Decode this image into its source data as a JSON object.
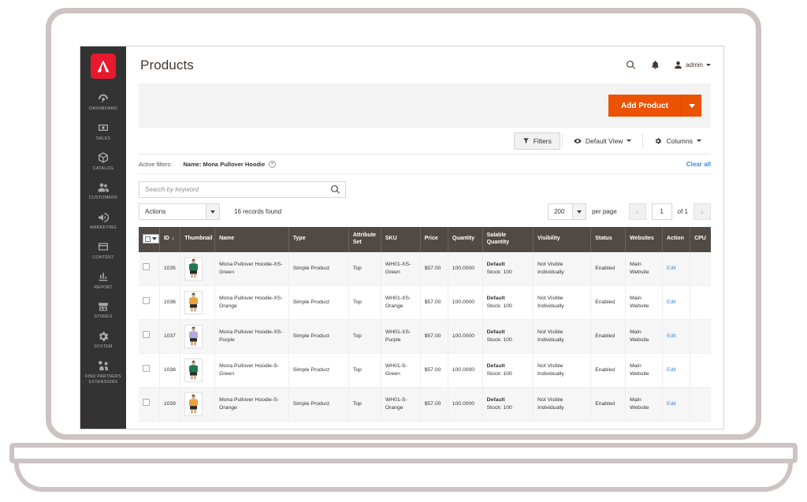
{
  "brand": {
    "logo_icon": "adobe-logo-icon",
    "logo_color": "#e8192c"
  },
  "sidebar": {
    "items": [
      {
        "label": "Dashboard",
        "icon": "dashboard-icon"
      },
      {
        "label": "Sales",
        "icon": "sales-icon"
      },
      {
        "label": "Catalog",
        "icon": "catalog-icon"
      },
      {
        "label": "Customers",
        "icon": "customers-icon"
      },
      {
        "label": "Marketing",
        "icon": "marketing-icon"
      },
      {
        "label": "Content",
        "icon": "content-icon"
      },
      {
        "label": "Report",
        "icon": "report-icon"
      },
      {
        "label": "Stores",
        "icon": "stores-icon"
      },
      {
        "label": "System",
        "icon": "system-icon"
      },
      {
        "label": "Find Partners\nExtensions",
        "icon": "partners-icon"
      }
    ]
  },
  "header": {
    "title": "Products",
    "search_icon": "search-icon",
    "notifications_icon": "bell-icon",
    "user_icon": "user-icon",
    "admin_name": "admin"
  },
  "actions": {
    "add_product_label": "Add Product",
    "add_product_color": "#eb5202",
    "add_product_caret_icon": "chevron-down-icon"
  },
  "toolbar": {
    "filters_label": "Filters",
    "filters_icon": "funnel-icon",
    "view_label": "Default View",
    "view_icon": "eye-icon",
    "columns_label": "Columns",
    "columns_icon": "gear-icon"
  },
  "active_filters": {
    "label": "Active filters:",
    "chip_text": "Name: Mona Pullover Hoodie",
    "remove_icon": "close-circle-icon",
    "clear_all_label": "Clear all",
    "link_color": "#3f8bd6"
  },
  "search": {
    "placeholder": "Search by keyword",
    "value": "",
    "icon": "search-icon"
  },
  "controls": {
    "actions_label": "Actions",
    "records_found": "16 records found",
    "per_page_value": "200",
    "per_page_label": "per page",
    "prev_icon": "chevron-left-icon",
    "next_icon": "chevron-right-icon",
    "page_value": "1",
    "page_total": "of 1"
  },
  "grid": {
    "columns": [
      {
        "key": "select",
        "label": ""
      },
      {
        "key": "id",
        "label": "ID",
        "sort": "↓"
      },
      {
        "key": "thumbnail",
        "label": "Thumbnail"
      },
      {
        "key": "name",
        "label": "Name"
      },
      {
        "key": "type",
        "label": "Type"
      },
      {
        "key": "attribute_set",
        "label": "Attribute Set"
      },
      {
        "key": "sku",
        "label": "SKU"
      },
      {
        "key": "price",
        "label": "Price"
      },
      {
        "key": "quantity",
        "label": "Quantity"
      },
      {
        "key": "salable_quantity",
        "label": "Salable Quantity"
      },
      {
        "key": "visibility",
        "label": "Visibility"
      },
      {
        "key": "status",
        "label": "Status"
      },
      {
        "key": "websites",
        "label": "Websites"
      },
      {
        "key": "action",
        "label": "Action"
      },
      {
        "key": "cpu",
        "label": "CPU"
      }
    ],
    "rows": [
      {
        "id": "1035",
        "thumb_color": "#1d7a4f",
        "name": "Mona Pullover Hoodie-XS-Green",
        "type": "Simple Product",
        "attribute_set": "Top",
        "sku": "WH01-XS-Green",
        "price": "$57.00",
        "quantity": "100.0000",
        "salable_label": "Default",
        "salable_value": "Stock: 100",
        "visibility": "Not Visible Individually",
        "status": "Enabled",
        "websites": "Main Website",
        "action": "Edit",
        "cpu": ""
      },
      {
        "id": "1036",
        "thumb_color": "#e8a33d",
        "name": "Mona Pullover Hoodie-XS-Orange",
        "type": "Simple Product",
        "attribute_set": "Top",
        "sku": "WH01-XS-Orange",
        "price": "$57.00",
        "quantity": "100.0000",
        "salable_label": "Default",
        "salable_value": "Stock: 100",
        "visibility": "Not Visible Individually",
        "status": "Enabled",
        "websites": "Main Website",
        "action": "Edit",
        "cpu": ""
      },
      {
        "id": "1037",
        "thumb_color": "#b6a8e0",
        "name": "Mona Pullover Hoodie-XS-Purple",
        "type": "Simple Product",
        "attribute_set": "Top",
        "sku": "WH01-XS-Purple",
        "price": "$57.00",
        "quantity": "100.0000",
        "salable_label": "Default",
        "salable_value": "Stock: 100",
        "visibility": "Not Visible Individually",
        "status": "Enabled",
        "websites": "Main Website",
        "action": "Edit",
        "cpu": ""
      },
      {
        "id": "1038",
        "thumb_color": "#1d7a4f",
        "name": "Mona Pullover Hoodie-S-Green",
        "type": "Simple Product",
        "attribute_set": "Top",
        "sku": "WH01-S-Green",
        "price": "$57.00",
        "quantity": "100.0000",
        "salable_label": "Default",
        "salable_value": "Stock: 100",
        "visibility": "Not Visible Individually",
        "status": "Enabled",
        "websites": "Main Website",
        "action": "Edit",
        "cpu": ""
      },
      {
        "id": "1039",
        "thumb_color": "#e8a33d",
        "name": "Mona Pullover Hoodie-S-Orange",
        "type": "Simple Product",
        "attribute_set": "Top",
        "sku": "WH01-S-Orange",
        "price": "$57.00",
        "quantity": "100.0000",
        "salable_label": "Default",
        "salable_value": "Stock: 100",
        "visibility": "Not Visible Individually",
        "status": "Enabled",
        "websites": "Main Website",
        "action": "Edit",
        "cpu": ""
      }
    ]
  }
}
